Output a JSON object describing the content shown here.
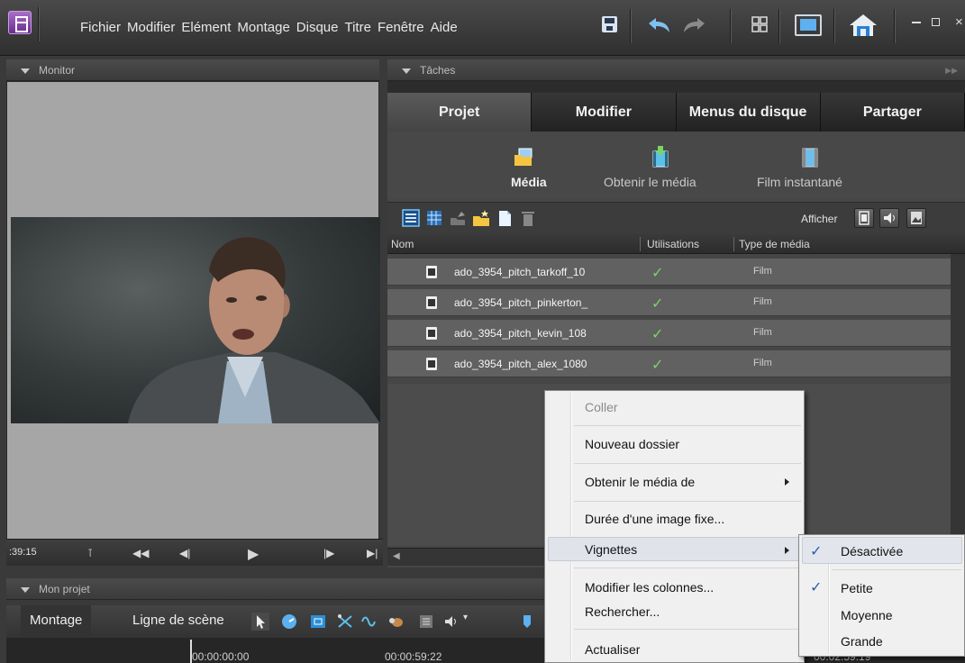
{
  "menubar": {
    "items": [
      "Fichier",
      "Modifier",
      "Elément",
      "Montage",
      "Disque",
      "Titre",
      "Fenêtre",
      "Aide"
    ],
    "window_controls": {
      "minimize": "–",
      "maximize": "□",
      "close": "×"
    }
  },
  "monitor": {
    "title": "Monitor",
    "timecode": ":39:15"
  },
  "tasks": {
    "title": "Tâches",
    "tabs": [
      "Projet",
      "Modifier",
      "Menus du disque",
      "Partager"
    ],
    "active_tab": "Projet",
    "subtabs": [
      "Média",
      "Obtenir le média",
      "Film instantané"
    ],
    "active_subtab": "Média",
    "toolbar": {
      "afficher_label": "Afficher"
    },
    "columns": [
      "Nom",
      "Utilisations",
      "Type de média"
    ],
    "rows": [
      {
        "name": "ado_3954_pitch_tarkoff_10",
        "used": "✓",
        "type": "Film"
      },
      {
        "name": "ado_3954_pitch_pinkerton_",
        "used": "✓",
        "type": "Film"
      },
      {
        "name": "ado_3954_pitch_kevin_108",
        "used": "✓",
        "type": "Film"
      },
      {
        "name": "ado_3954_pitch_alex_1080",
        "used": "✓",
        "type": "Film"
      }
    ]
  },
  "project": {
    "title": "Mon projet",
    "tabs": [
      "Montage",
      "Ligne de scène"
    ],
    "active_tab": "Montage",
    "timecodes": [
      "00:00:00:00",
      "00:00:59:22",
      "00:02:59:19"
    ]
  },
  "context_menu": {
    "items": [
      {
        "label": "Coller",
        "disabled": true
      },
      {
        "label": "Nouveau dossier"
      },
      {
        "label": "Obtenir le média de",
        "submenu": true
      },
      {
        "label": "Durée d'une image fixe..."
      },
      {
        "label": "Vignettes",
        "submenu": true,
        "highlighted": true
      },
      {
        "label": "Modifier les colonnes..."
      },
      {
        "label": "Rechercher..."
      },
      {
        "label": "Actualiser"
      }
    ]
  },
  "submenu": {
    "items": [
      {
        "label": "Désactivée",
        "checked": true
      },
      {
        "label": "Petite",
        "checked": true
      },
      {
        "label": "Moyenne",
        "checked": false
      },
      {
        "label": "Grande",
        "checked": false
      }
    ],
    "check_glyph": "✓"
  },
  "colors": {
    "accent": "#6a2c8f",
    "check_green": "#7bd36a",
    "check_blue": "#2a5fb0"
  }
}
